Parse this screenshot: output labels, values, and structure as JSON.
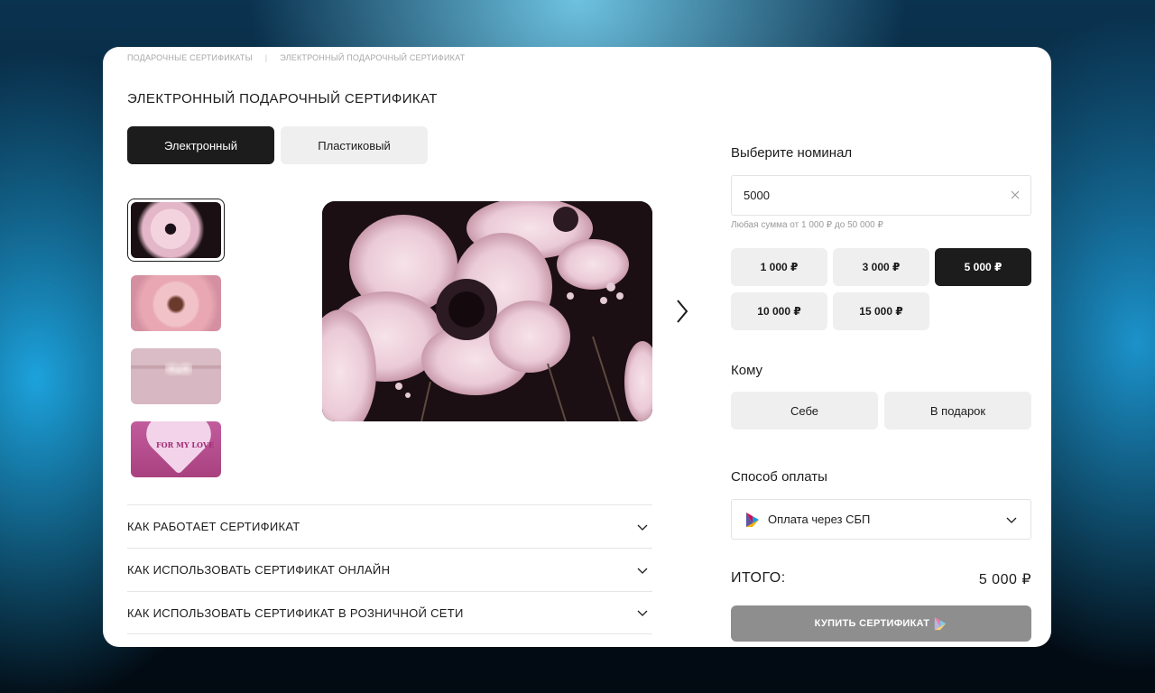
{
  "breadcrumb": {
    "items": [
      "ПОДАРОЧНЫЕ СЕРТИФИКАТЫ",
      "ЭЛЕКТРОННЫЙ ПОДАРОЧНЫЙ СЕРТИФИКАТ"
    ],
    "separator": "|"
  },
  "page": {
    "title": "ЭЛЕКТРОННЫЙ ПОДАРОЧНЫЙ СЕРТИФИКАТ"
  },
  "type_tabs": [
    {
      "label": "Электронный",
      "active": true
    },
    {
      "label": "Пластиковый",
      "active": false
    }
  ],
  "thumbnails": {
    "selected_index": 0,
    "items": [
      {
        "name": "anemone-flower-thumbnail"
      },
      {
        "name": "peony-flower-thumbnail"
      },
      {
        "name": "pink-bow-thumbnail"
      },
      {
        "name": "heart-for-my-love-thumbnail",
        "text": "FOR MY LOVE"
      }
    ]
  },
  "accordion": [
    {
      "label": "КАК РАБОТАЕТ СЕРТИФИКАТ"
    },
    {
      "label": "КАК ИСПОЛЬЗОВАТЬ СЕРТИФИКАТ ОНЛАЙН"
    },
    {
      "label": "КАК ИСПОЛЬЗОВАТЬ СЕРТИФИКАТ В РОЗНИЧНОЙ СЕТИ"
    }
  ],
  "nominal": {
    "title": "Выберите номинал",
    "input_value": "5000",
    "hint": "Любая сумма от 1 000 ₽ до 50 000 ₽",
    "options": [
      "1 000 ₽",
      "3 000 ₽",
      "5 000 ₽",
      "10 000 ₽",
      "15 000 ₽"
    ],
    "selected": "5 000 ₽"
  },
  "recipient": {
    "title": "Кому",
    "options": [
      "Себе",
      "В подарок"
    ]
  },
  "payment": {
    "title": "Способ оплаты",
    "selected": "Оплата через СБП"
  },
  "total": {
    "label": "ИТОГО:",
    "value": "5 000 ₽"
  },
  "buy_button": {
    "label": "КУПИТЬ СЕРТИФИКАТ"
  },
  "colors": {
    "accent_dark": "#1c1c1c",
    "chip_bg": "#efefef",
    "button_disabled": "#8e8e8e"
  }
}
